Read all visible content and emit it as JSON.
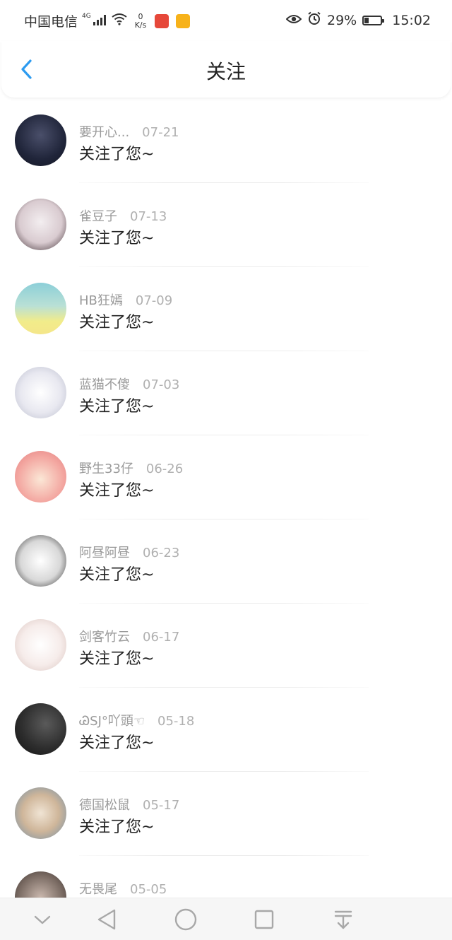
{
  "status_bar": {
    "carrier": "中国电信",
    "network": "4G",
    "speed_value": "0",
    "speed_unit": "K/s",
    "battery": "29%",
    "battery_level": 0.29,
    "time": "15:02"
  },
  "header": {
    "title": "关注",
    "back_icon": "chevron-left-icon"
  },
  "colors": {
    "accent": "#2d9bf0",
    "text_primary": "#222222",
    "text_secondary": "#9a9a9a"
  },
  "followers": [
    {
      "name": "要开心...",
      "date": "07-21",
      "message": "关注了您~"
    },
    {
      "name": "雀豆子",
      "date": "07-13",
      "message": "关注了您~"
    },
    {
      "name": "HB狂嫣",
      "date": "07-09",
      "message": "关注了您~"
    },
    {
      "name": "蓝猫不傻",
      "date": "07-03",
      "message": "关注了您~"
    },
    {
      "name": "野生33仔",
      "date": "06-26",
      "message": "关注了您~"
    },
    {
      "name": "阿昼阿昼",
      "date": "06-23",
      "message": "关注了您~"
    },
    {
      "name": "剑客竹云",
      "date": "06-17",
      "message": "关注了您~"
    },
    {
      "name": "ᏊSJ°吖頭☜",
      "date": "05-18",
      "message": "关注了您~"
    },
    {
      "name": "德国松鼠",
      "date": "05-17",
      "message": "关注了您~"
    },
    {
      "name": "无畏尾",
      "date": "05-05",
      "message": ""
    }
  ],
  "nav": {
    "icons": [
      "chevron-down-icon",
      "back-triangle-icon",
      "home-circle-icon",
      "recents-square-icon",
      "pull-down-icon"
    ]
  }
}
